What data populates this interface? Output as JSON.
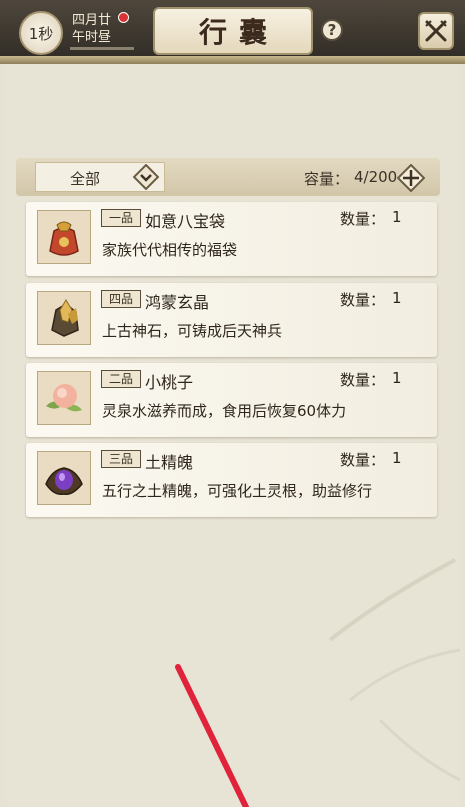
{
  "header": {
    "timer": "1秒",
    "date_line1": "四月廿",
    "date_line2": "午时昼",
    "title": "行囊",
    "help_icon": "question-icon",
    "close_icon": "crossed-swords-icon"
  },
  "filter": {
    "selected": "全部",
    "capacity_label": "容量：",
    "capacity_value": "4/200"
  },
  "items": [
    {
      "grade": "一品",
      "name": "如意八宝袋",
      "qty_label": "数量：",
      "qty": "1",
      "desc": "家族代代相传的福袋",
      "icon": "lucky-bag-icon"
    },
    {
      "grade": "四品",
      "name": "鸿蒙玄晶",
      "qty_label": "数量：",
      "qty": "1",
      "desc": "上古神石，可铸成后天神兵",
      "icon": "crystal-ore-icon"
    },
    {
      "grade": "二品",
      "name": "小桃子",
      "qty_label": "数量：",
      "qty": "1",
      "desc": "灵泉水滋养而成，食用后恢复60体力",
      "icon": "peach-icon"
    },
    {
      "grade": "三品",
      "name": "土精魄",
      "qty_label": "数量：",
      "qty": "1",
      "desc": "五行之土精魄，可强化土灵根，助益修行",
      "icon": "earth-essence-icon"
    }
  ],
  "colors": {
    "accent_red": "#d93434",
    "panel_bg": "#e7e3d5"
  }
}
